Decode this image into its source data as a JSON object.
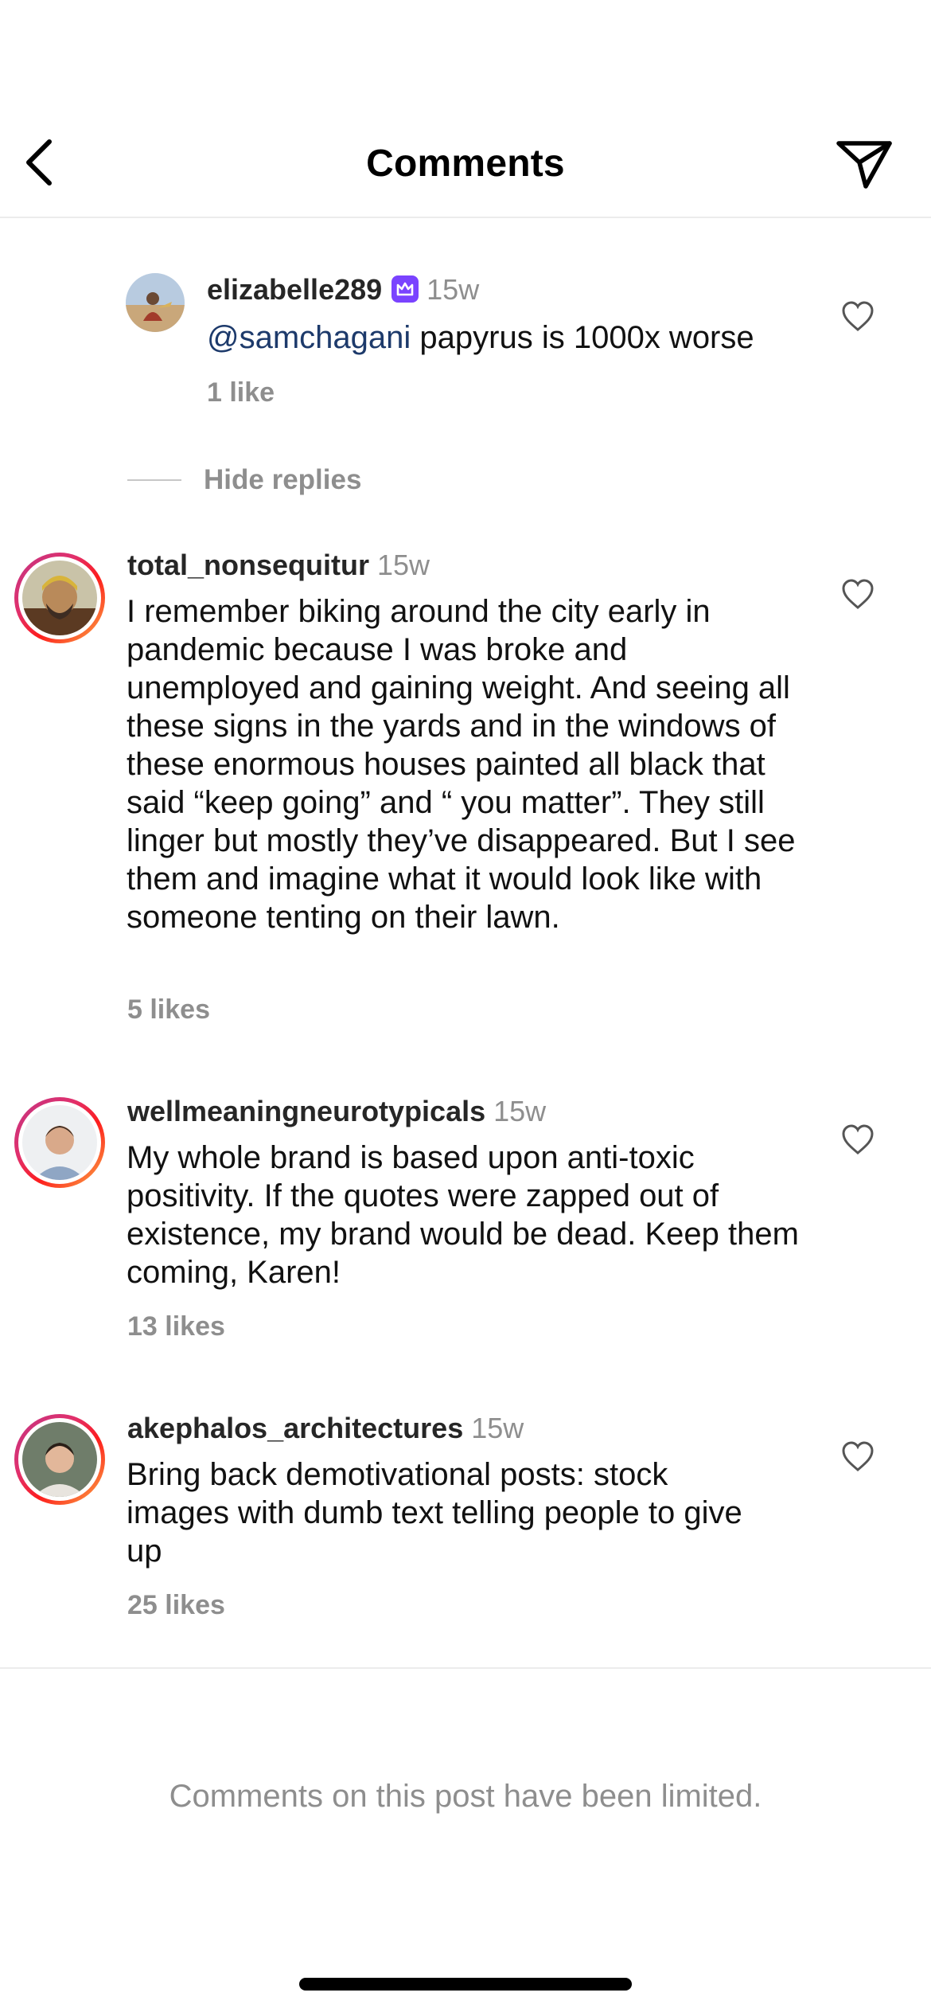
{
  "header": {
    "title": "Comments",
    "back_icon": "chevron-left-icon",
    "send_icon": "paper-plane-icon"
  },
  "reply": {
    "username": "elizabelle289",
    "badge_icon": "crown-badge-icon",
    "time": "15w",
    "mention": "@samchagani",
    "text": " papyrus is 1000x worse",
    "likes": "1 like"
  },
  "hide_replies": "Hide replies",
  "comments": [
    {
      "username": "total_nonsequitur",
      "time": "15w",
      "text": "I remember biking around the city early in pandemic because I was broke and unemployed and gaining weight. And seeing all these signs in the yards and in the windows of these enormous houses painted all black that said “keep going” and “ you matter”. They still linger but mostly they’ve disappeared. But I see them and imagine what it would look like with someone tenting on their lawn.",
      "likes": "5 likes"
    },
    {
      "username": "wellmeaningneurotypicals",
      "time": "15w",
      "text": "My whole brand is based upon anti-toxic positivity. If the quotes were zapped out of existence, my brand would be dead. Keep them coming, Karen!",
      "likes": "13 likes"
    },
    {
      "username": "akephalos_architectures",
      "time": "15w",
      "text": "Bring back demotivational posts: stock images with dumb text telling people to give up",
      "likes": "25 likes"
    }
  ],
  "footer": {
    "limited_text": "Comments on this post have been limited."
  },
  "colors": {
    "mention": "#1d3a6b",
    "secondary_text": "#8e8e8e",
    "badge": "#7a43ff"
  }
}
